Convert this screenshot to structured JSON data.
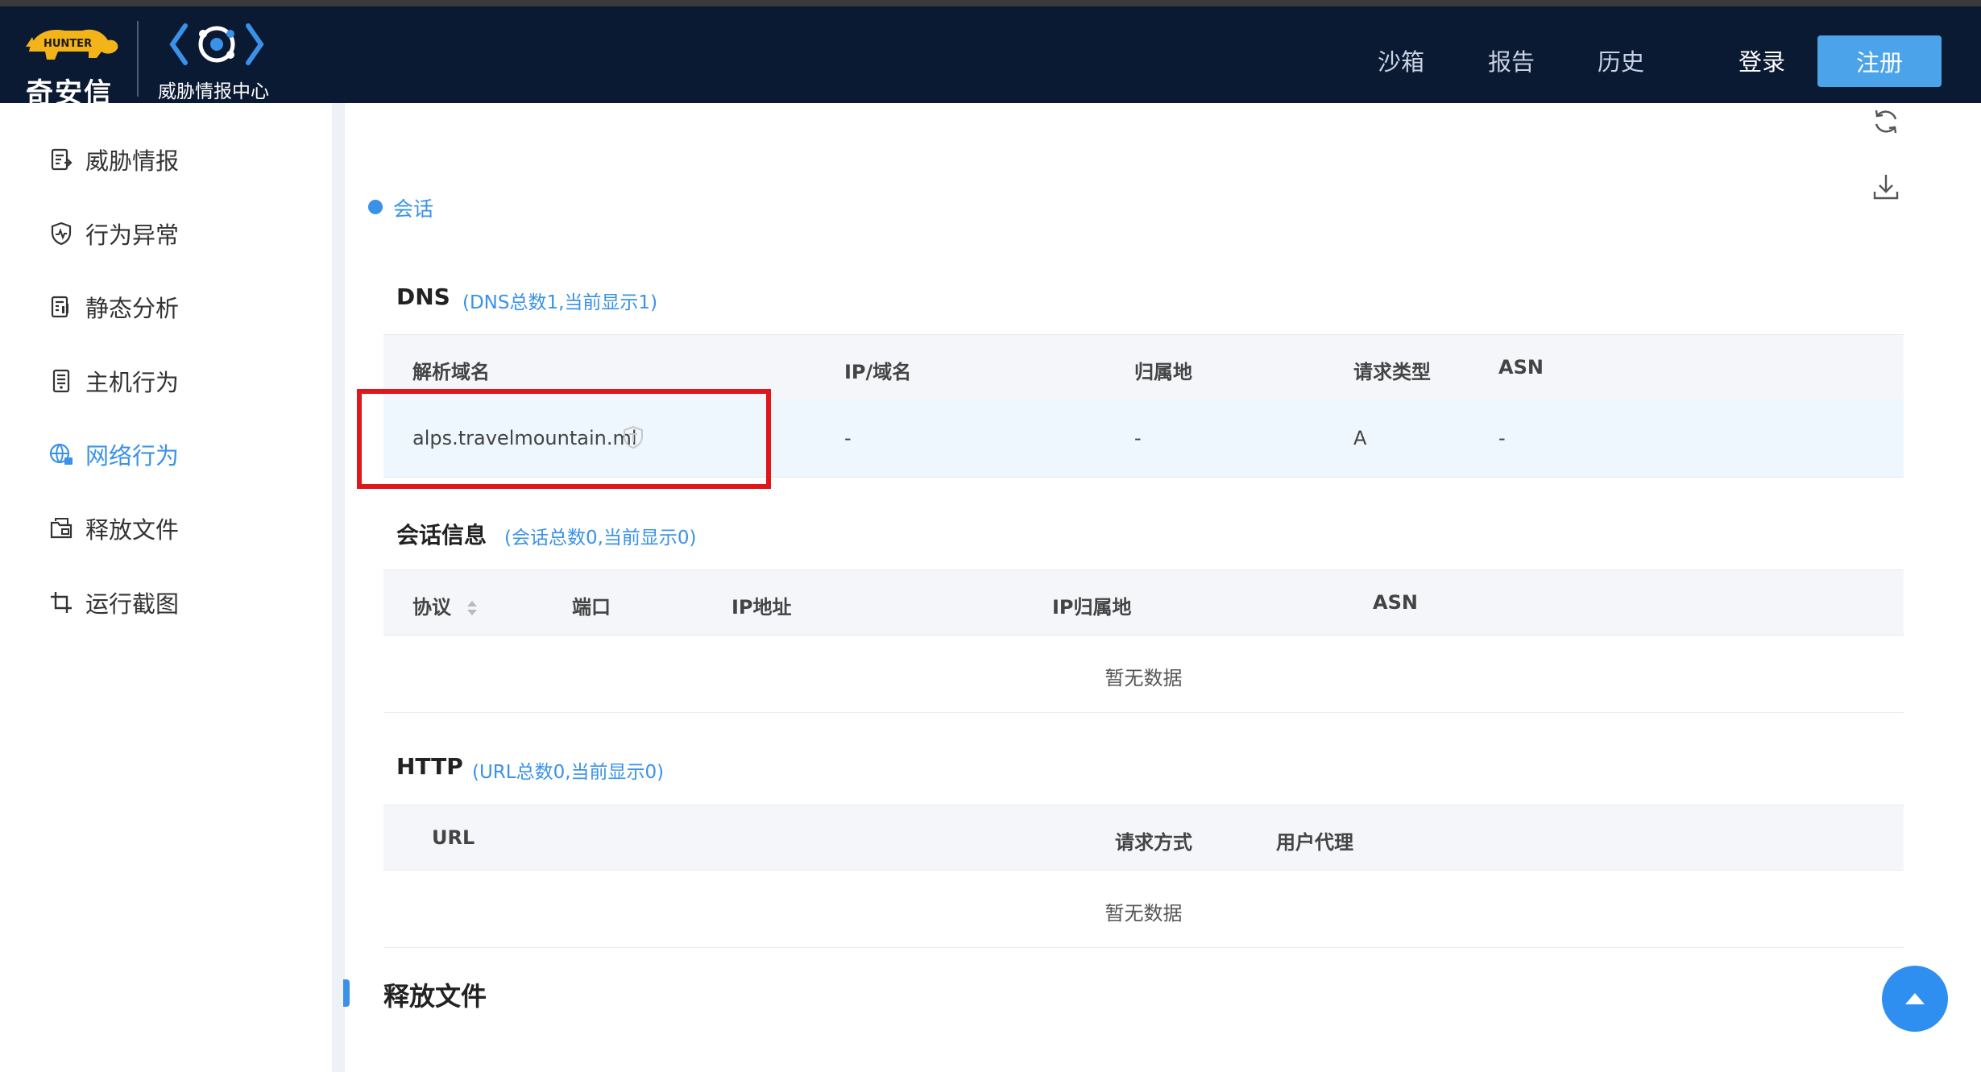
{
  "header": {
    "brand_name": "奇安信",
    "logo_mascot_text": "HUNTER",
    "product_name": "威胁情报中心",
    "nav": [
      {
        "label": "沙箱"
      },
      {
        "label": "报告"
      },
      {
        "label": "历史"
      }
    ],
    "login_label": "登录",
    "register_label": "注册",
    "colors": {
      "bar": "#0b1a33",
      "register": "#4ba3ea"
    }
  },
  "sidebar": {
    "items": [
      {
        "label": "威胁情报",
        "icon": "threat-intel-icon"
      },
      {
        "label": "行为异常",
        "icon": "shield-icon"
      },
      {
        "label": "静态分析",
        "icon": "static-analysis-icon"
      },
      {
        "label": "主机行为",
        "icon": "host-icon"
      },
      {
        "label": "网络行为",
        "icon": "network-icon",
        "active": true
      },
      {
        "label": "释放文件",
        "icon": "release-file-icon"
      },
      {
        "label": "运行截图",
        "icon": "screenshot-icon"
      }
    ],
    "active_color": "#3a92e8"
  },
  "toolbar": {
    "refresh_icon": "refresh-icon",
    "download_icon": "download-icon"
  },
  "session_label": "会话",
  "dns": {
    "title": "DNS",
    "subtitle": "(DNS总数1,当前显示1)",
    "columns": [
      "解析域名",
      "IP/域名",
      "归属地",
      "请求类型",
      "ASN"
    ],
    "rows": [
      {
        "domain": "alps.travelmountain.ml",
        "ip": "-",
        "location": "-",
        "type": "A",
        "asn": "-"
      }
    ]
  },
  "session_info": {
    "title": "会话信息",
    "subtitle": "(会话总数0,当前显示0)",
    "columns": [
      "协议",
      "端口",
      "IP地址",
      "IP归属地",
      "ASN"
    ],
    "empty_text": "暂无数据"
  },
  "http": {
    "title": "HTTP",
    "subtitle": "(URL总数0,当前显示0)",
    "columns": [
      "URL",
      "请求方式",
      "用户代理"
    ],
    "empty_text": "暂无数据"
  },
  "release_section_title": "释放文件",
  "highlight_color": "#e0161b"
}
